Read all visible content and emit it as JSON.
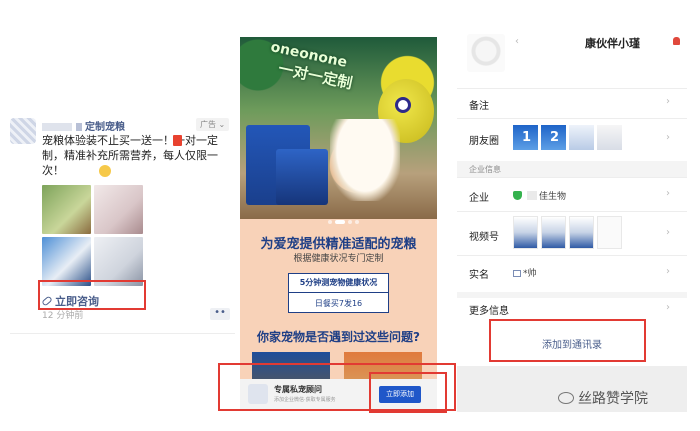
{
  "moments_ad": {
    "account_name": "定制宠粮",
    "ad_tag": "广告",
    "text": "宠粮体验装不止买一送一！一对一定制，精准补充所需营养，每人仅限一次！",
    "consult_link": "立即咨询",
    "time_ago": "12 分钟前",
    "more": "••"
  },
  "landing": {
    "hero_title": "oneonone",
    "hero_subtitle": "一对一定制",
    "headline": "为爱宠提供精准适配的宠粮",
    "subhead": "根据健康状况专门定制",
    "test_button": "5分钟测宠物健康状况",
    "test_note": "日餐买7发16",
    "question": "你家宠物是否遇到过这些问题?",
    "bottom_bar": {
      "title": "专属私宠顾问",
      "subtitle": "添加企业微信·获取专属服务",
      "add_button": "立即添加"
    }
  },
  "contact": {
    "name": "康伙伴小瑾",
    "rows": {
      "remark": "备注",
      "moments": "朋友圈",
      "section_enterprise": "企业信息",
      "company": "企业",
      "company_value": "佳生物",
      "channels": "视频号",
      "real_name": "实名",
      "real_name_value": "*帅",
      "more_info": "更多信息"
    },
    "moments_thumbs": [
      "1",
      "2"
    ],
    "add_to_contacts": "添加到通讯录"
  },
  "watermark": "丝路赞学院",
  "colors": {
    "highlight_red": "#e23a33",
    "link_blue": "#4a5e8b",
    "brand_blue": "#1f3f86",
    "landing_bg": "#f8d2b8"
  }
}
